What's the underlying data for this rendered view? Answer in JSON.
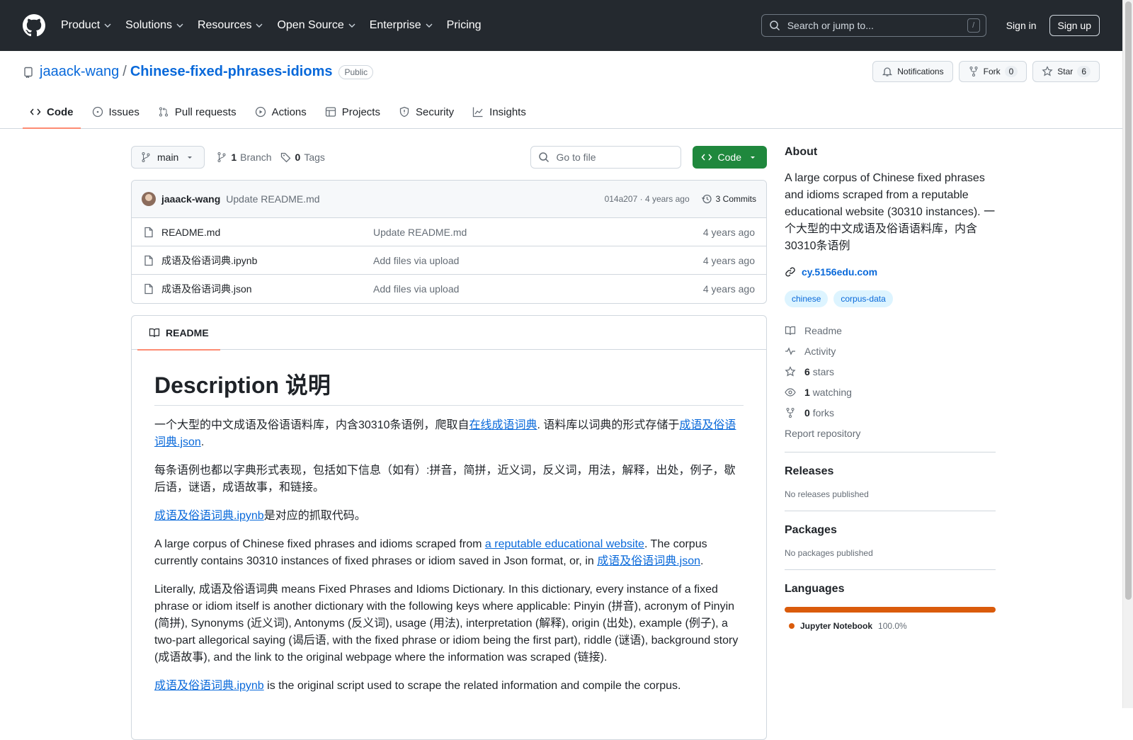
{
  "header": {
    "nav": [
      "Product",
      "Solutions",
      "Resources",
      "Open Source",
      "Enterprise",
      "Pricing"
    ],
    "search_placeholder": "Search or jump to...",
    "slash_key": "/",
    "sign_in": "Sign in",
    "sign_up": "Sign up"
  },
  "repo": {
    "owner": "jaaack-wang",
    "separator": "/",
    "name": "Chinese-fixed-phrases-idioms",
    "visibility": "Public",
    "notifications_label": "Notifications",
    "fork_label": "Fork",
    "fork_count": "0",
    "star_label": "Star",
    "star_count": "6"
  },
  "tabs": [
    "Code",
    "Issues",
    "Pull requests",
    "Actions",
    "Projects",
    "Security",
    "Insights"
  ],
  "toolbar": {
    "branch": "main",
    "branch_count": "1",
    "branch_label": "Branch",
    "tag_count": "0",
    "tag_label": "Tags",
    "goto_placeholder": "Go to file",
    "code_button": "Code"
  },
  "latest_commit": {
    "author": "jaaack-wang",
    "message": "Update README.md",
    "hash_time": "014a207 · 4 years ago",
    "commits_label": "3 Commits"
  },
  "files": [
    {
      "name": "README.md",
      "message": "Update README.md",
      "time": "4 years ago"
    },
    {
      "name": "成语及俗语词典.ipynb",
      "message": "Add files via upload",
      "time": "4 years ago"
    },
    {
      "name": "成语及俗语词典.json",
      "message": "Add files via upload",
      "time": "4 years ago"
    }
  ],
  "readme": {
    "tab_label": "README",
    "heading": "Description 说明",
    "p1_a": "一个大型的中文成语及俗语语料库，内含30310条语例，爬取自",
    "p1_link1": "在线成语词典",
    "p1_b": ". 语料库以词典的形式存储于",
    "p1_link2": "成语及俗语词典.json",
    "p1_c": ".",
    "p2": "每条语例也都以字典形式表现，包括如下信息（如有）:拼音，简拼，近义词，反义词，用法，解释，出处，例子，歇后语，谜语，成语故事，和链接。",
    "p3_link": "成语及俗语词典.ipynb",
    "p3_text": "是对应的抓取代码。",
    "p4_a": "A large corpus of Chinese fixed phrases and idioms scraped from ",
    "p4_link1": "a reputable educational website",
    "p4_b": ". The corpus currently contains 30310 instances of fixed phrases or idiom saved in Json format, or, in ",
    "p4_link2": "成语及俗语词典.json",
    "p4_c": ".",
    "p5": "Literally, 成语及俗语词典 means Fixed Phrases and Idioms Dictionary. In this dictionary, every instance of a fixed phrase or idiom itself is another dictionary with the following keys where applicable: Pinyin (拼音), acronym of Pinyin (简拼), Synonyms (近义词), Antonyms (反义词), usage (用法), interpretation (解释), origin (出处), example (例子), a two-part allegorical saying (谒后语, with the fixed phrase or idiom being the first part), riddle (谜语), background story (成语故事), and the link to the original webpage where the information was scraped (链接).",
    "p6_link": "成语及俗语词典.ipynb",
    "p6_text": " is the original script used to scrape the related information and compile the corpus."
  },
  "about": {
    "title": "About",
    "description": "A large corpus of Chinese fixed phrases and idioms scraped from a reputable educational website (30310 instances). 一个大型的中文成语及俗语语料库，内含30310条语例",
    "website": "cy.5156edu.com",
    "topics": [
      "chinese",
      "corpus-data"
    ],
    "readme": "Readme",
    "activity": "Activity",
    "stars_count": "6",
    "stars_label": "stars",
    "watching_count": "1",
    "watching_label": "watching",
    "forks_count": "0",
    "forks_label": "forks",
    "report": "Report repository"
  },
  "releases": {
    "title": "Releases",
    "empty": "No releases published"
  },
  "packages": {
    "title": "Packages",
    "empty": "No packages published"
  },
  "languages": {
    "title": "Languages",
    "items": [
      {
        "name": "Jupyter Notebook",
        "percent": "100.0%",
        "color": "#DA5B0B"
      }
    ]
  }
}
